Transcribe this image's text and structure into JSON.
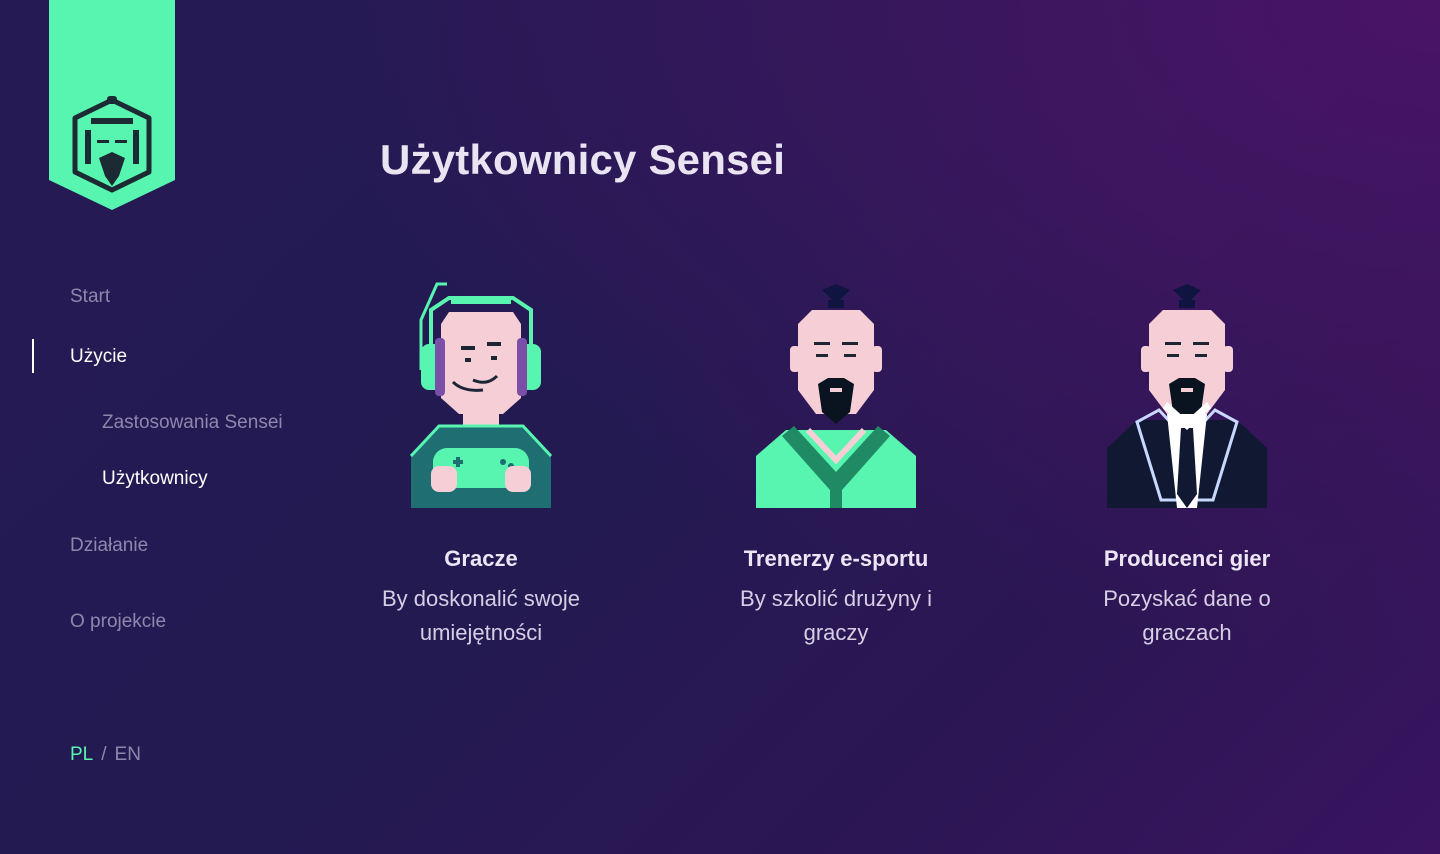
{
  "page": {
    "title": "Użytkownicy Sensei"
  },
  "nav": {
    "items": [
      {
        "label": "Start"
      },
      {
        "label": "Użycie"
      },
      {
        "label": "Zastosowania Sensei"
      },
      {
        "label": "Użytkownicy"
      },
      {
        "label": "Działanie"
      },
      {
        "label": "O projekcie"
      }
    ]
  },
  "language": {
    "pl": "PL",
    "separator": "/",
    "en": "EN"
  },
  "cards": [
    {
      "title": "Gracze",
      "description": "By doskonalić swoje umiejętności"
    },
    {
      "title": "Trenerzy e-sportu",
      "description": "By szkolić drużyny i graczy"
    },
    {
      "title": "Producenci gier",
      "description": "Pozyskać dane o graczach"
    }
  ],
  "colors": {
    "accent": "#58f5b0",
    "background": "#241a54",
    "text": "#e9e3f2",
    "muted": "#8f87ab"
  }
}
